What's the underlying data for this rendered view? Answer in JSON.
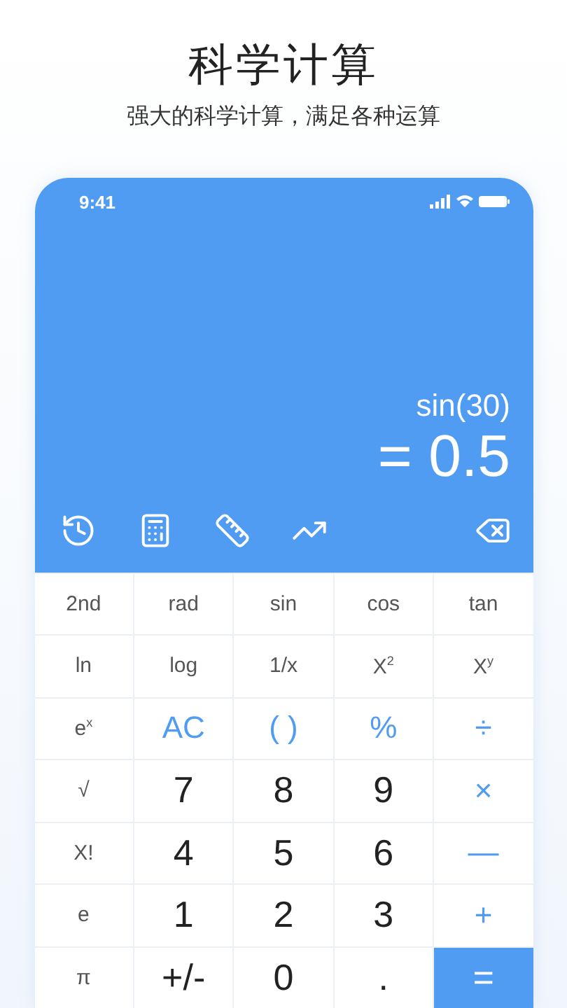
{
  "header": {
    "title": "科学计算",
    "subtitle": "强大的科学计算，满足各种运算"
  },
  "status_bar": {
    "time": "9:41"
  },
  "display": {
    "expression": "sin(30)",
    "result": "= 0.5"
  },
  "toolbar": [
    {
      "kind": "history"
    },
    {
      "kind": "calculator"
    },
    {
      "kind": "ruler"
    },
    {
      "kind": "chart"
    },
    {
      "kind": "backspace"
    }
  ],
  "keypad": [
    [
      {
        "label": "2nd",
        "kind": "fn"
      },
      {
        "label": "rad",
        "kind": "fn"
      },
      {
        "label": "sin",
        "kind": "fn"
      },
      {
        "label": "cos",
        "kind": "fn"
      },
      {
        "label": "tan",
        "kind": "fn"
      }
    ],
    [
      {
        "label": "ln",
        "kind": "fn"
      },
      {
        "label": "log",
        "kind": "fn"
      },
      {
        "label": "1/x",
        "kind": "fn"
      },
      {
        "label": "X$^{2}$",
        "kind": "fn"
      },
      {
        "label": "X$^{y}$",
        "kind": "fn"
      }
    ],
    [
      {
        "label": "e$^{x}$",
        "kind": "fn"
      },
      {
        "label": "AC",
        "kind": "op"
      },
      {
        "label": "( )",
        "kind": "op"
      },
      {
        "label": "%",
        "kind": "op"
      },
      {
        "label": "÷",
        "kind": "op"
      }
    ],
    [
      {
        "label": "√",
        "kind": "fn"
      },
      {
        "label": "7",
        "kind": "digit"
      },
      {
        "label": "8",
        "kind": "digit"
      },
      {
        "label": "9",
        "kind": "digit"
      },
      {
        "label": "×",
        "kind": "op"
      }
    ],
    [
      {
        "label": "X!",
        "kind": "fn"
      },
      {
        "label": "4",
        "kind": "digit"
      },
      {
        "label": "5",
        "kind": "digit"
      },
      {
        "label": "6",
        "kind": "digit"
      },
      {
        "label": "—",
        "kind": "op"
      }
    ],
    [
      {
        "label": "e",
        "kind": "fn"
      },
      {
        "label": "1",
        "kind": "digit"
      },
      {
        "label": "2",
        "kind": "digit"
      },
      {
        "label": "3",
        "kind": "digit"
      },
      {
        "label": "+",
        "kind": "op"
      }
    ],
    [
      {
        "label": "π",
        "kind": "fn"
      },
      {
        "label": "+/-",
        "kind": "digit"
      },
      {
        "label": "0",
        "kind": "digit"
      },
      {
        "label": ".",
        "kind": "digit"
      },
      {
        "label": "=",
        "kind": "equals"
      }
    ]
  ]
}
